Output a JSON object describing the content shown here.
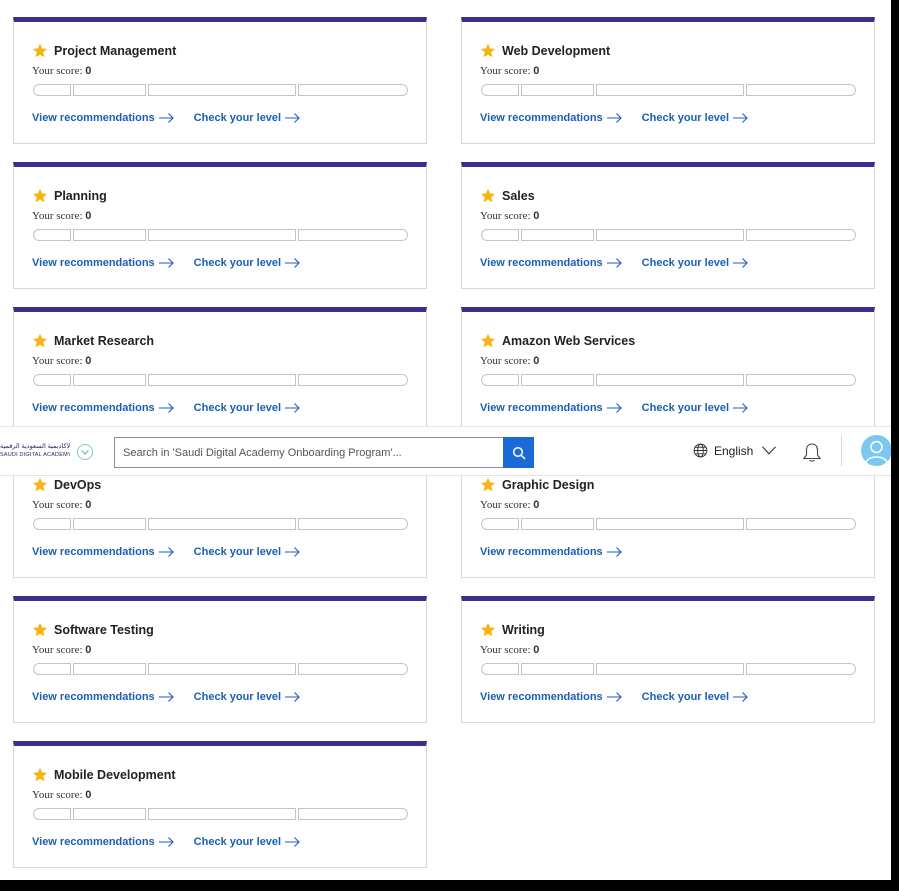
{
  "colors": {
    "card_top_bar": "#3e2d8c",
    "link": "#1b5fb5",
    "star": "#f5b514",
    "search_button": "#1b6ad8",
    "avatar": "#7cc8ee"
  },
  "labels": {
    "score_prefix": "Your score:",
    "view_recommendations": "View recommendations",
    "check_level": "Check your level"
  },
  "cards": [
    {
      "title": "Project Management",
      "score": "0",
      "show_check_level": true
    },
    {
      "title": "Web Development",
      "score": "0",
      "show_check_level": true
    },
    {
      "title": "Planning",
      "score": "0",
      "show_check_level": true
    },
    {
      "title": "Sales",
      "score": "0",
      "show_check_level": true
    },
    {
      "title": "Market Research",
      "score": "0",
      "show_check_level": true
    },
    {
      "title": "Amazon Web Services",
      "score": "0",
      "show_check_level": true
    },
    {
      "title": "DevOps",
      "score": "0",
      "show_check_level": true
    },
    {
      "title": "Graphic Design",
      "score": "0",
      "show_check_level": false
    },
    {
      "title": "Software Testing",
      "score": "0",
      "show_check_level": true
    },
    {
      "title": "Writing",
      "score": "0",
      "show_check_level": true
    },
    {
      "title": "Mobile Development",
      "score": "0",
      "show_check_level": true
    }
  ],
  "header": {
    "logo_arabic": "الأكاديمية السعودية الرقمية",
    "logo_english": "SAUDI DIGITAL ACADEMY",
    "search_placeholder": "Search in 'Saudi Digital Academy Onboarding Program'...",
    "language": "English",
    "icons": [
      "chevron-down-icon",
      "search-icon",
      "globe-icon",
      "chevron-down-icon",
      "bell-icon",
      "avatar-icon"
    ]
  }
}
